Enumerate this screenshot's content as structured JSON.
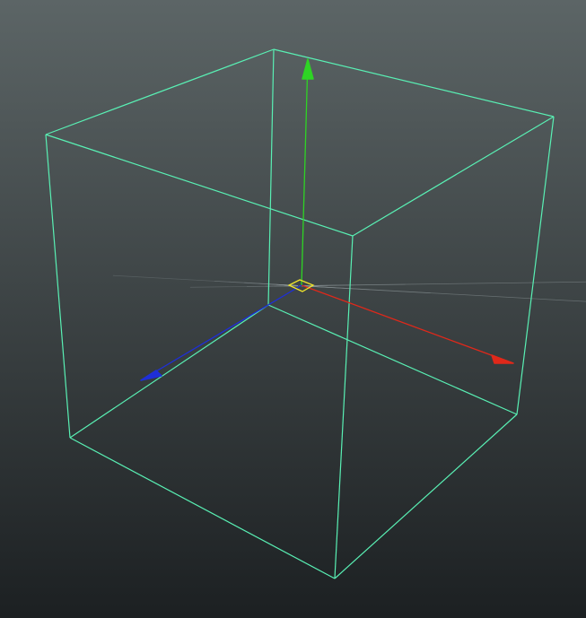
{
  "viewport": {
    "view": "perspective",
    "background_top": "#5c6566",
    "background_bottom": "#1c2022"
  },
  "colors": {
    "grid_line": "#8a9395",
    "grid_center_tint": "#2e6b4e",
    "world_axis": "#000000",
    "wireframe": "#59f0b4",
    "manipulator_x": "#e0281a",
    "manipulator_y": "#2ed424",
    "manipulator_z": "#1e2fd8",
    "pivot": "#f0e62a"
  },
  "scene": {
    "grid": {
      "visible": true
    },
    "selected_object": {
      "type": "cube",
      "display": "wireframe",
      "selected": true
    },
    "manipulator": {
      "type": "move",
      "axes": [
        "x",
        "y",
        "z"
      ],
      "active_handles": [
        "x-handle",
        "y-handle",
        "z-handle"
      ]
    },
    "icons": {
      "pivot": "pivot-center-icon"
    }
  }
}
